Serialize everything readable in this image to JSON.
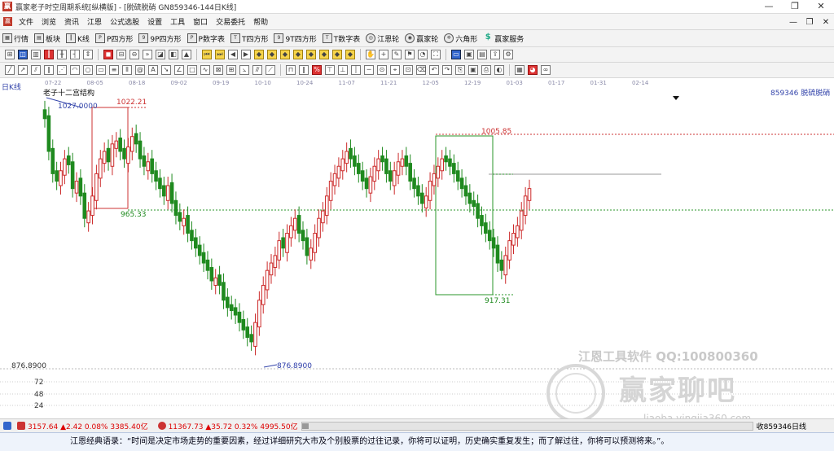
{
  "window": {
    "title": "赢家老子时空周期系统[纵横版] - [脱硫脱硝  GN859346-144日K线]",
    "controls": [
      "—",
      "❐",
      "✕"
    ]
  },
  "menu": {
    "items": [
      "文件",
      "浏览",
      "资讯",
      "江恩",
      "公式选股",
      "设置",
      "工具",
      "窗口",
      "交易委托",
      "帮助"
    ]
  },
  "toolbar": {
    "buttons": [
      {
        "icon": "grid-icon",
        "label": "行情"
      },
      {
        "icon": "blocks-icon",
        "label": "板块"
      },
      {
        "icon": "candle-icon",
        "label": "K线"
      },
      {
        "icon": "p-square-icon",
        "label": "P四方形"
      },
      {
        "icon": "9p-square-icon",
        "label": "9P四方形"
      },
      {
        "icon": "p-numeric-icon",
        "label": "P数字表"
      },
      {
        "icon": "t-square-icon",
        "label": "T四方形"
      },
      {
        "icon": "9t-square-icon",
        "label": "9T四方形"
      },
      {
        "icon": "t-numeric-icon",
        "label": "T数字表"
      },
      {
        "icon": "gann-wheel-icon",
        "label": "江恩轮"
      },
      {
        "icon": "winner-wheel-icon",
        "label": "赢家轮"
      },
      {
        "icon": "hexagon-icon",
        "label": "六角形"
      },
      {
        "icon": "dollar-icon",
        "label": "赢家服务"
      }
    ]
  },
  "chart": {
    "panel_label": "日K线",
    "study_name": "老子十二宫结构",
    "security": "859346 脱硫脱硝",
    "date_ticks": [
      "07-22",
      "08-05",
      "08-18",
      "09-02",
      "09-19",
      "10-10",
      "10-24",
      "11-07",
      "11-21",
      "12-05",
      "12-19",
      "01-03",
      "01-17",
      "01-31",
      "02-14"
    ],
    "annotations": {
      "high_start": "1027.0000",
      "box1_top": "1022.21",
      "box1_bottom": "965.33",
      "box2_top": "1005.85",
      "box2_bottom": "917.31",
      "low": "876.8900",
      "axis_low": "876.8900"
    },
    "volume_ticks": [
      "72",
      "48",
      "24"
    ],
    "colors": {
      "up": "#cc2a2a",
      "down": "#1f8a1f",
      "box_red": "#cc3333",
      "box_green": "#2a962a",
      "low_label": "#2b3ba8"
    }
  },
  "chart_data": {
    "type": "candlestick",
    "title": "老子十二宫结构",
    "y_range": [
      860,
      1040
    ],
    "series": [
      {
        "name": "859346 脱硫脱硝",
        "values": [
          1027,
          1005,
          990,
          985,
          992,
          1000,
          996,
          980,
          985,
          975,
          960,
          965,
          975,
          990,
          1000,
          1005,
          998,
          1010,
          1012,
          1005,
          1000,
          1008,
          1015,
          1010,
          1000,
          995,
          998,
          990,
          985,
          980,
          975,
          982,
          970,
          962,
          958,
          960,
          950,
          945,
          940,
          935,
          930,
          925,
          918,
          920,
          915,
          905,
          900,
          898,
          895,
          890,
          885,
          880,
          877,
          890,
          905,
          915,
          925,
          930,
          935,
          945,
          940,
          950,
          955,
          960,
          950,
          945,
          935,
          940,
          950,
          960,
          965,
          975,
          985,
          990,
          995,
          1000,
          1005,
          1000,
          995,
          990,
          985,
          980,
          988,
          995,
          1000,
          998,
          990,
          985,
          992,
          998,
          1000,
          995,
          985,
          980,
          975,
          970,
          975,
          985,
          990,
          995,
          1000,
          998,
          995,
          990,
          985,
          980,
          975,
          970,
          968,
          960,
          955,
          950,
          945,
          940,
          930,
          925,
          935,
          945,
          950,
          955,
          965,
          975,
          980
        ]
      }
    ]
  },
  "status": {
    "sh_index": "3157.64 ▲2.42 0.08% 3385.40亿",
    "sz_index": "11367.73 ▲35.72 0.32% 4995.50亿",
    "right": "收859346日线"
  },
  "watermark": {
    "line1": "江恩工具软件   QQ:100800360",
    "line2": "赢家聊吧",
    "line3": "liaoba.yingjia360.com"
  },
  "quote": "江恩经典语录：“时间是决定市场走势的重要因素，经过详细研究大市及个别股票的过往记录，你将可以证明，历史确实重复发生；而了解过往，你将可以预测将来。”。"
}
